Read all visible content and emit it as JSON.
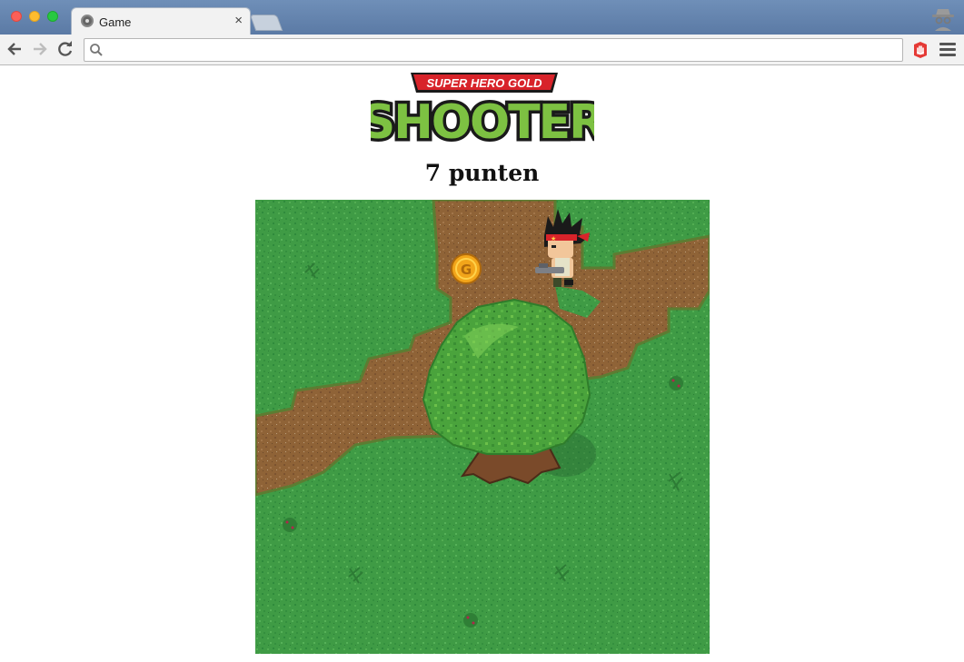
{
  "browser": {
    "tab_title": "Game",
    "tab_close": "×",
    "address_value": "",
    "address_placeholder": "",
    "icons": {
      "back": "arrow-left-icon",
      "forward": "arrow-right-icon",
      "reload": "reload-icon",
      "search": "magnifier-icon",
      "extension": "hand-stop-icon",
      "menu": "hamburger-icon",
      "profile": "incognito-spy-icon"
    }
  },
  "logo": {
    "banner_text": "SUPER HERO GOLD",
    "main_text": "SHOOTER",
    "colors": {
      "banner": "#d8232a",
      "main": "#7dc142",
      "outline": "#1a1a1a"
    }
  },
  "score": {
    "text": "7 punten"
  },
  "game": {
    "colors": {
      "grass": "#3f9b45",
      "grass_dark": "#2f8a3c",
      "dirt": "#8f6337",
      "dirt_edge": "#5c7d32",
      "tree": "#4aa33c",
      "coin": "#f2a51a"
    },
    "sprites": {
      "player": "hero-with-headband-and-gun",
      "coin": "gold-coin-G",
      "tree": "large-oak-tree"
    }
  }
}
